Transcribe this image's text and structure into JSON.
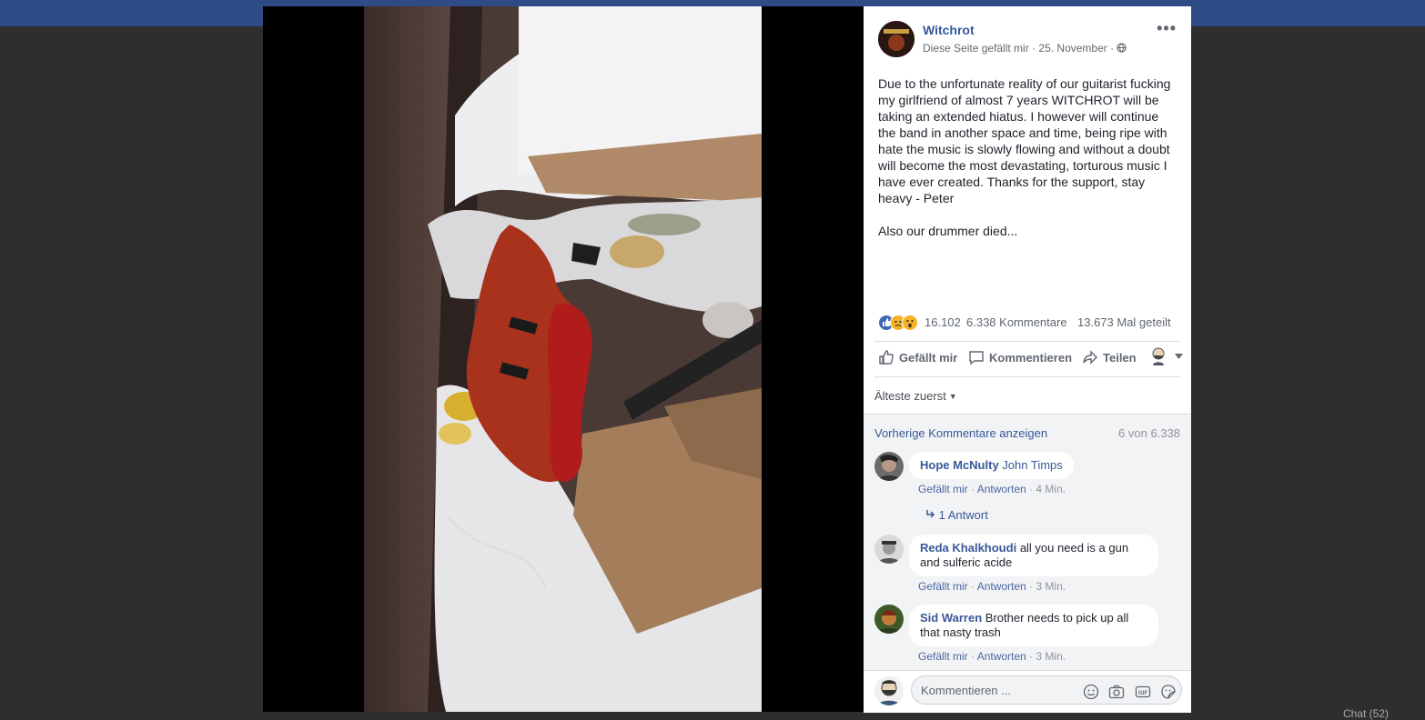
{
  "colors": {
    "link": "#385898",
    "page_name": "#365899",
    "meta_grey": "#616770",
    "comment_bg": "#f2f3f5",
    "like_blue": "#4267b2",
    "reaction_yellow": "#f7b125"
  },
  "viewer": {
    "photo_description_icon": "photo-icon"
  },
  "post": {
    "page_name": "Witchrot",
    "liked_status": "Diese Seite gefällt mir",
    "separator": "·",
    "date": "25. November",
    "privacy_icon": "globe-icon",
    "more_icon": "•••",
    "text": "Due to the unfortunate reality of our guitarist fucking my girlfriend of almost 7 years WITCHROT will be taking an extended hiatus. I however will continue the band in another space and time, being ripe with hate the music is slowly flowing and without a doubt will become the most devastating, torturous music I have ever created. Thanks for the support, stay heavy - Peter\n\nAlso our drummer died..."
  },
  "stats": {
    "reactions": "16.102",
    "comments": "6.338 Kommentare",
    "shares": "13.673 Mal geteilt"
  },
  "actions": {
    "like": "Gefällt mir",
    "comment": "Kommentieren",
    "share": "Teilen"
  },
  "comments_section": {
    "sort": "Älteste zuerst",
    "previous": "Vorherige Kommentare anzeigen",
    "count": "6 von 6.338",
    "items": [
      {
        "author": "Hope McNulty",
        "text": "John Timps",
        "like": "Gefällt mir",
        "reply": "Antworten",
        "time": "4 Min.",
        "replies": "1 Antwort"
      },
      {
        "author": "Reda Khalkhoudi",
        "text": "all you need is a gun and sulferic acide",
        "like": "Gefällt mir",
        "reply": "Antworten",
        "time": "3 Min."
      },
      {
        "author": "Sid Warren",
        "text": "Brother needs to pick up all that nasty trash",
        "like": "Gefällt mir",
        "reply": "Antworten",
        "time": "3 Min."
      }
    ]
  },
  "composer": {
    "placeholder": "Kommentieren ..."
  },
  "background": {
    "chat_label": "Chat (52)"
  }
}
